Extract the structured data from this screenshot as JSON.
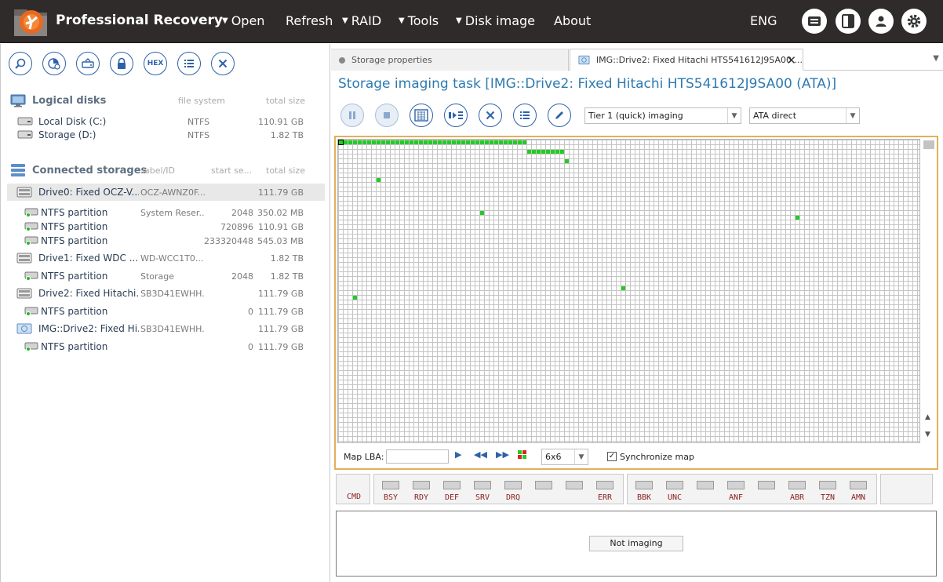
{
  "app": {
    "title": "Professional Recovery",
    "language": "ENG"
  },
  "menu": [
    {
      "label": "Open",
      "has_dropdown": true
    },
    {
      "label": "Refresh",
      "has_dropdown": false
    },
    {
      "label": "RAID",
      "has_dropdown": true
    },
    {
      "label": "Tools",
      "has_dropdown": true
    },
    {
      "label": "Disk image",
      "has_dropdown": true
    },
    {
      "label": "About",
      "has_dropdown": false
    }
  ],
  "top_icons": [
    "log-icon",
    "panel-icon",
    "user-icon",
    "settings-icon"
  ],
  "left_toolbar": [
    "search-icon",
    "partition-icon",
    "copy-icon",
    "lock-icon",
    "hex-icon",
    "list-icon",
    "close-icon"
  ],
  "hex_label": "HEX",
  "logical_disks": {
    "title": "Logical disks",
    "col_fs": "file system",
    "col_size": "total size",
    "items": [
      {
        "name": "Local Disk (C:)",
        "fs": "NTFS",
        "size": "110.91 GB"
      },
      {
        "name": "Storage (D:)",
        "fs": "NTFS",
        "size": "1.82 TB"
      }
    ]
  },
  "connected_storages": {
    "title": "Connected storages",
    "col_label": "label/ID",
    "col_start": "start se...",
    "col_size": "total size",
    "items": [
      {
        "type": "drive",
        "name": "Drive0: Fixed OCZ-V...",
        "label": "OCZ-AWNZ0F...",
        "start": "",
        "size": "111.79 GB",
        "selected": true
      },
      {
        "type": "partition",
        "name": "NTFS partition",
        "label": "System Reser...",
        "start": "2048",
        "size": "350.02 MB"
      },
      {
        "type": "partition",
        "name": "NTFS partition",
        "label": "",
        "start": "720896",
        "size": "110.91 GB"
      },
      {
        "type": "partition",
        "name": "NTFS partition",
        "label": "",
        "start": "233320448",
        "size": "545.03 MB"
      },
      {
        "type": "drive",
        "name": "Drive1: Fixed WDC ...",
        "label": "WD-WCC1T0...",
        "start": "",
        "size": "1.82 TB"
      },
      {
        "type": "partition",
        "name": "NTFS partition",
        "label": "Storage",
        "start": "2048",
        "size": "1.82 TB"
      },
      {
        "type": "drive",
        "name": "Drive2: Fixed Hitachi...",
        "label": "SB3D41EWHH...",
        "start": "",
        "size": "111.79 GB"
      },
      {
        "type": "partition",
        "name": "NTFS partition",
        "label": "",
        "start": "0",
        "size": "111.79 GB"
      },
      {
        "type": "image",
        "name": "IMG::Drive2: Fixed Hi...",
        "label": "SB3D41EWHH...",
        "start": "",
        "size": "111.79 GB"
      },
      {
        "type": "partition",
        "name": "NTFS partition",
        "label": "",
        "start": "0",
        "size": "111.79 GB"
      }
    ]
  },
  "tabs": [
    {
      "label": "Storage properties",
      "active": false
    },
    {
      "label": "IMG::Drive2: Fixed Hitachi HTS541612J9SA00 ...",
      "active": true
    }
  ],
  "task": {
    "title": "Storage imaging task [IMG::Drive2: Fixed Hitachi HTS541612J9SA00 (ATA)]",
    "toolbar": [
      "pause-icon",
      "stop-icon",
      "map-icon",
      "transfer-icon",
      "cancel-icon",
      "list-icon",
      "edit-icon"
    ],
    "mode_select": "Tier 1 (quick) imaging",
    "access_select": "ATA direct"
  },
  "map": {
    "lba_label": "Map LBA:",
    "lba_value": "",
    "block_size": "6x6",
    "sync_label": "Synchronize map",
    "sync_checked": true
  },
  "status": {
    "cmd_label": "CMD",
    "group1": [
      "BSY",
      "RDY",
      "DEF",
      "SRV",
      "DRQ",
      "",
      "",
      "ERR"
    ],
    "group2": [
      "BBK",
      "UNC",
      "",
      "ANF",
      "",
      "ABR",
      "TZN",
      "AMN"
    ],
    "state": "Not imaging"
  }
}
